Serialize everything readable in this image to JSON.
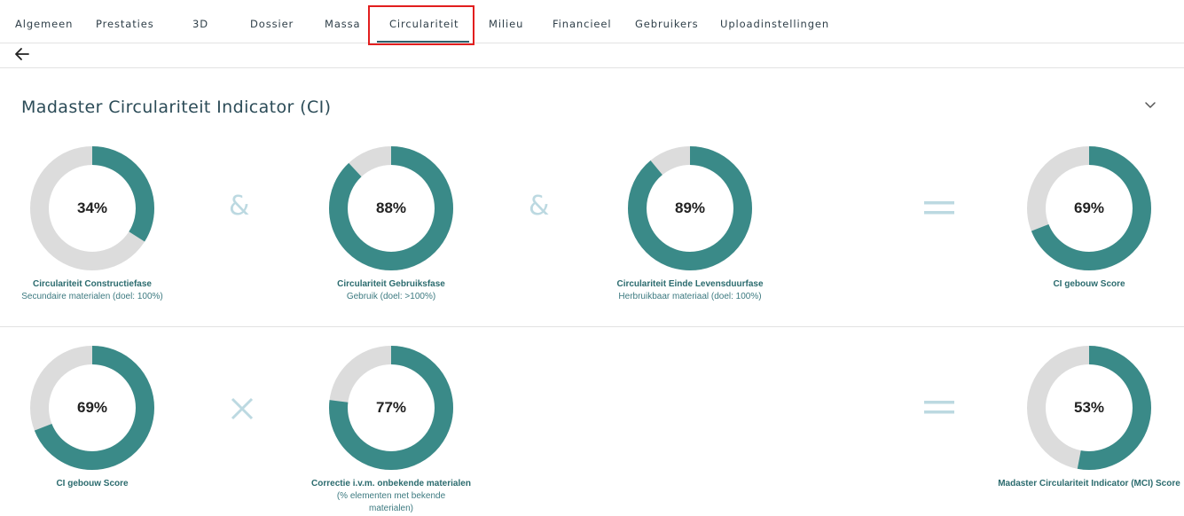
{
  "tabs": [
    {
      "label": "Algemeen"
    },
    {
      "label": "Prestaties"
    },
    {
      "label": "3D"
    },
    {
      "label": "Dossier"
    },
    {
      "label": "Massa"
    },
    {
      "label": "Circulariteit"
    },
    {
      "label": "Milieu"
    },
    {
      "label": "Financieel"
    },
    {
      "label": "Gebruikers"
    },
    {
      "label": "Uploadinstellingen"
    }
  ],
  "active_tab": "Circulariteit",
  "section": {
    "title": "Madaster Circulariteit Indicator (CI)"
  },
  "colors": {
    "accent": "#3a8a88",
    "track": "#dcdcdc",
    "operator": "#bcd9e1",
    "highlight": "#e21e1e"
  },
  "row1": {
    "items": [
      {
        "pct_label": "34%",
        "value": 0.34,
        "title": "Circulariteit Constructiefase",
        "sub": "Secundaire materialen (doel: 100%)"
      },
      {
        "pct_label": "88%",
        "value": 0.88,
        "title": "Circulariteit Gebruiksfase",
        "sub": "Gebruik (doel: >100%)"
      },
      {
        "pct_label": "89%",
        "value": 0.89,
        "title": "Circulariteit Einde Levensduurfase",
        "sub": "Herbruikbaar materiaal (doel: 100%)"
      },
      {
        "pct_label": "69%",
        "value": 0.69,
        "title": "CI gebouw Score",
        "sub": ""
      }
    ],
    "operators": [
      "&",
      "&",
      "="
    ]
  },
  "row2": {
    "items": [
      {
        "pct_label": "69%",
        "value": 0.69,
        "title": "CI gebouw Score",
        "sub": ""
      },
      {
        "pct_label": "77%",
        "value": 0.77,
        "title": "Correctie i.v.m. onbekende materialen",
        "sub": "(% elementen met bekende materialen)"
      },
      {
        "pct_label": "53%",
        "value": 0.53,
        "title": "Madaster Circulariteit Indicator (MCI) Score",
        "sub": ""
      }
    ],
    "operators": [
      "×",
      "="
    ]
  }
}
